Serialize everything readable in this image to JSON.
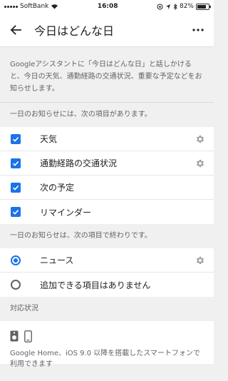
{
  "status_bar": {
    "carrier": "SoftBank",
    "time": "16:08",
    "battery_percent": "82%",
    "battery_level": 0.82
  },
  "app_bar": {
    "title": "今日はどんな日"
  },
  "description": "Googleアシスタントに「今日はどんな日」と話しかけると、今日の天気、通勤経路の交通状況、重要な予定などをお知らせします。",
  "section_items_header": "一日のお知らせには、次の項目があります。",
  "items": [
    {
      "label": "天気",
      "checked": true,
      "has_settings": true
    },
    {
      "label": "通勤経路の交通状況",
      "checked": true,
      "has_settings": true
    },
    {
      "label": "次の予定",
      "checked": true,
      "has_settings": false
    },
    {
      "label": "リマインダー",
      "checked": true,
      "has_settings": false
    }
  ],
  "section_end_header": "一日のお知らせは、次の項目で終わりです。",
  "end_options": [
    {
      "label": "ニュース",
      "selected": true,
      "has_settings": true
    },
    {
      "label": "追加できる項目はありません",
      "selected": false,
      "has_settings": false
    }
  ],
  "compat_header": "対応状況",
  "compat_text": "Google Home、iOS 9.0 以降を搭載したスマートフォンで利用できます",
  "colors": {
    "accent": "#1a73e8",
    "background": "#f0f0f0",
    "surface": "#ffffff"
  }
}
